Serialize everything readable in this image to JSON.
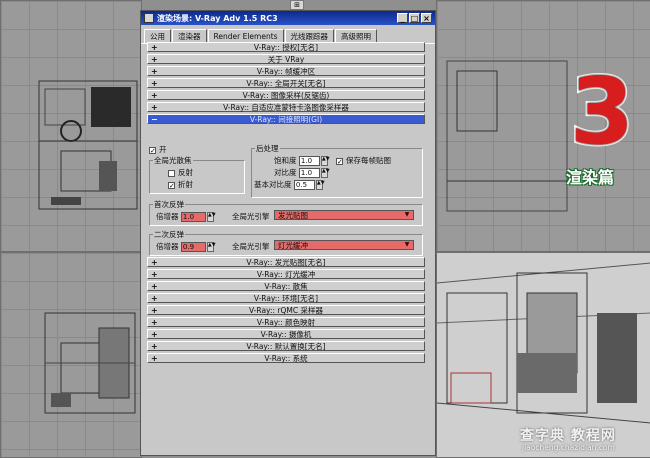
{
  "dialog": {
    "title": "渲染场景: V-Ray Adv 1.5 RC3",
    "window_buttons": [
      "_",
      "□",
      "×"
    ]
  },
  "tabs": [
    "公用",
    "渲染器",
    "Render Elements",
    "光线跟踪器",
    "高级照明"
  ],
  "rollouts_top": [
    "V-Ray:: 授权[无名]",
    "关于 VRay",
    "V-Ray:: 帧缓冲区",
    "V-Ray:: 全局开关[无名]",
    "V-Ray:: 图像采样(反锯齿)",
    "V-Ray:: 自适应准蒙特卡洛图像采样器",
    "V-Ray:: 间接照明(GI)"
  ],
  "gi": {
    "on_label": "开",
    "caustics_group": "全局光散焦",
    "reflective": "反射",
    "refractive": "折射",
    "post_group": "后处理",
    "saturation_label": "饱和度",
    "saturation": "1.0",
    "contrast_label": "对比度",
    "contrast": "1.0",
    "contrast_base_label": "基本对比度",
    "contrast_base": "0.5",
    "save_maps": "保存每帧贴图",
    "primary_group": "首次反弹",
    "primary_mult_label": "倍增器",
    "primary_mult": "1.0",
    "primary_engine_label": "全局光引擎",
    "primary_engine": "发光贴图",
    "secondary_group": "二次反弹",
    "secondary_mult_label": "倍增器",
    "secondary_mult": "0.9",
    "secondary_engine_label": "全局光引擎",
    "secondary_engine": "灯光缓冲"
  },
  "rollouts_bottom": [
    "V-Ray:: 发光贴图[无名]",
    "V-Ray:: 灯光缓冲",
    "V-Ray:: 散焦",
    "V-Ray:: 环境[无名]",
    "V-Ray:: rQMC 采样器",
    "V-Ray:: 颜色映射",
    "V-Ray:: 摄像机",
    "V-Ray:: 默认置换[无名]",
    "V-Ray:: 系统"
  ],
  "overlay": {
    "big_number": "3",
    "badge": "渲染篇",
    "watermark_top": "查字典 教程网",
    "watermark_bottom": "jiaocheng.chazidian.com"
  },
  "colors": {
    "title_bar": "#2852c8",
    "active_rollout": "#3a5bd0",
    "highlight_field": "#e66a6a",
    "big_number": "#d71d1d",
    "badge_outline": "#1a6a2a"
  }
}
